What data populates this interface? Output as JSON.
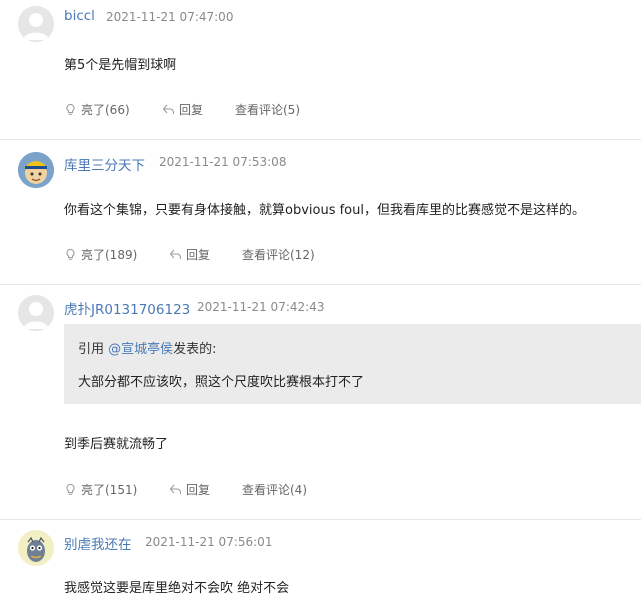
{
  "comments": [
    {
      "username": "biccl",
      "time": "2021-11-21 07:47:00",
      "text": "第5个是先帽到球啊",
      "actions": {
        "like": "亮了(66)",
        "reply": "回复",
        "view": "查看评论(5)"
      }
    },
    {
      "username": "库里三分天下",
      "time": "2021-11-21 07:53:08",
      "text": "你看这个集锦，只要有身体接触，就算obvious foul，但我看库里的比赛感觉不是这样的。",
      "actions": {
        "like": "亮了(189)",
        "reply": "回复",
        "view": "查看评论(12)"
      }
    },
    {
      "username": "虎扑JR0131706123",
      "time": "2021-11-21 07:42:43",
      "quote": {
        "prefix": "引用 ",
        "mention": "@宣城亭侯",
        "suffix": "发表的:",
        "text": "大部分都不应该吹，照这个尺度吹比赛根本打不了"
      },
      "text": "到季后赛就流畅了",
      "actions": {
        "like": "亮了(151)",
        "reply": "回复",
        "view": "查看评论(4)"
      }
    },
    {
      "username": "别虐我还在",
      "time": "2021-11-21 07:56:01",
      "text": "我感觉这要是库里绝对不会吹 绝对不会"
    }
  ],
  "icons": {
    "like": "lightbulb-icon",
    "reply": "reply-arrow-icon"
  },
  "colors": {
    "username": "#4a7ab5",
    "quote_bg": "#ebebeb",
    "divider": "#e6e6e6"
  }
}
